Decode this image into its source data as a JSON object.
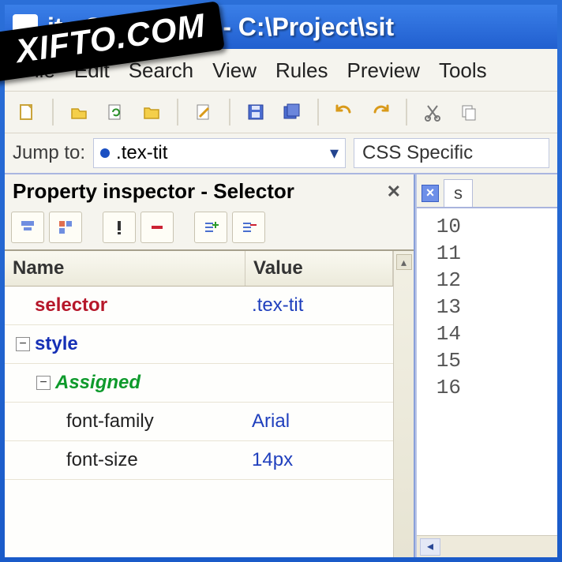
{
  "watermark": "XIFTO.COM",
  "window": {
    "title": "ite CSS Editor - C:\\Project\\sit"
  },
  "menu": {
    "items": [
      "File",
      "Edit",
      "Search",
      "View",
      "Rules",
      "Preview",
      "Tools"
    ]
  },
  "toolbar": {
    "icons": [
      "new-file-icon",
      "open-icon",
      "reload-icon",
      "open-folder-icon",
      "edit-doc-icon",
      "save-icon",
      "save-all-icon",
      "undo-icon",
      "redo-icon",
      "cut-icon",
      "copy-icon"
    ]
  },
  "jump": {
    "label": "Jump to:",
    "value": ".tex-tit",
    "spec_label": "CSS Specific"
  },
  "inspector": {
    "title": "Property inspector - Selector",
    "columns": {
      "name": "Name",
      "value": "Value"
    },
    "rows": [
      {
        "kind": "selector",
        "name": "selector",
        "value": ".tex-tit"
      },
      {
        "kind": "group",
        "name": "style",
        "value": ""
      },
      {
        "kind": "subgroup",
        "name": "Assigned",
        "value": ""
      },
      {
        "kind": "prop",
        "name": "font-family",
        "value": "Arial"
      },
      {
        "kind": "prop",
        "name": "font-size",
        "value": "14px"
      }
    ]
  },
  "editor": {
    "tab_label": "s",
    "line_numbers": [
      "10",
      "11",
      "12",
      "13",
      "14",
      "15",
      "16"
    ]
  }
}
